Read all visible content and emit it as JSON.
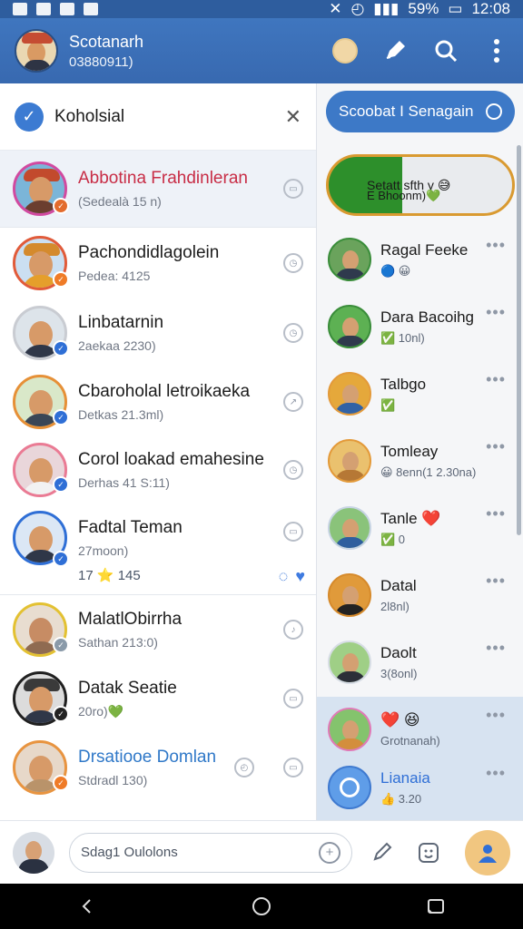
{
  "status_bar": {
    "time": "12:08",
    "battery": "59%"
  },
  "header": {
    "title": "Scotanarh",
    "subtitle": "03880911)",
    "colors": {
      "primary": "#3d73bb",
      "accent": "#2f6fd6"
    }
  },
  "left_group": {
    "label": "Koholsial"
  },
  "left_chats": [
    {
      "name": "Abbotina Frahdinleran",
      "sub": "(Sedealà 15 n)",
      "state": "active"
    },
    {
      "name": "Pachondidlagolein",
      "sub": "Pedea: 4125"
    },
    {
      "name": "Linbatarnin",
      "sub": "2aekaa 2230)"
    },
    {
      "name": "Cbaroholal letroikaeka",
      "sub": "Detkas 21.3ml)"
    },
    {
      "name": "Corol loakad emahesine",
      "sub": "Derhas 41 S:11)"
    },
    {
      "name": "Fadtal Teman",
      "sub": "27moon)",
      "extra": "17 ⭐ 145"
    },
    {
      "name": "MalatlObirrha",
      "sub": "Sathan 213:0)"
    },
    {
      "name": "Datak Seatie",
      "sub": "20ro)💚"
    },
    {
      "name": "Drsatiooe Domlan",
      "sub": "Stdradl 130)"
    }
  ],
  "right_pane": {
    "search_label": "Scoobat I Senagain",
    "banner_line1": "Setatt sfth y 😅",
    "banner_line2": "E Bhoonm)💚",
    "items": [
      {
        "name": "Ragal Feeke",
        "sub": "🔵 😀"
      },
      {
        "name": "Dara Bacoihg",
        "sub": "✅ 10nl)"
      },
      {
        "name": "Talbgo",
        "sub": "✅"
      },
      {
        "name": "Tomleay",
        "sub": "😀 8enn(1 2.30na)"
      },
      {
        "name": "Tanle ❤️",
        "sub": "✅ 0"
      },
      {
        "name": "Datal",
        "sub": "2l8nl)"
      },
      {
        "name": "Daolt",
        "sub": "3(8onl)"
      },
      {
        "name": "❤️ 😆",
        "sub": "Grotnanah)"
      },
      {
        "name": "Lianaia",
        "sub": "👍 3.20"
      }
    ]
  },
  "composer": {
    "placeholder": "Sdag1 Oulolons"
  },
  "icons": {
    "search": "search-icon",
    "edit": "edit-icon",
    "menu": "more-vert-icon",
    "close": "close-icon",
    "plus": "plus-icon",
    "attach": "attach-icon",
    "emoji": "emoji-icon",
    "profile": "person-icon",
    "nav_back": "back-icon",
    "nav_home": "home-icon",
    "nav_recent": "recent-icon"
  }
}
